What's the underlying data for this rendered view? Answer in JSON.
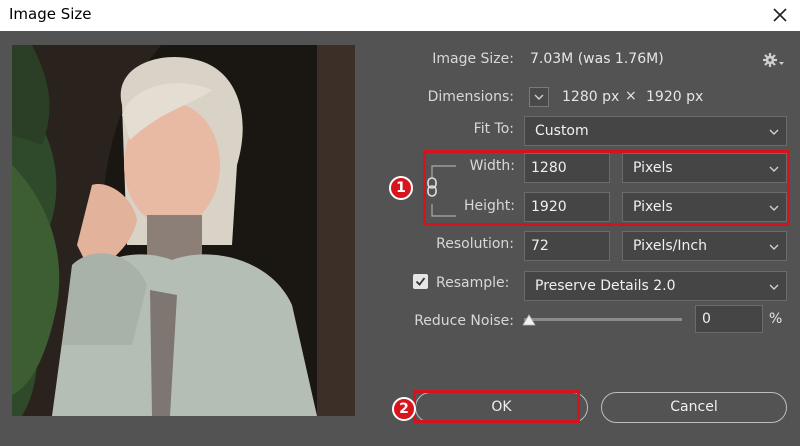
{
  "window": {
    "title": "Image Size"
  },
  "image_size": {
    "label": "Image Size:",
    "value": "7.03M (was 1.76M)"
  },
  "dimensions": {
    "label": "Dimensions:",
    "width": "1280 px",
    "separator": "×",
    "height": "1920 px"
  },
  "fit_to": {
    "label": "Fit To:",
    "value": "Custom"
  },
  "width": {
    "label": "Width:",
    "value": "1280",
    "unit": "Pixels"
  },
  "height": {
    "label": "Height:",
    "value": "1920",
    "unit": "Pixels"
  },
  "resolution": {
    "label": "Resolution:",
    "value": "72",
    "unit": "Pixels/Inch"
  },
  "resample": {
    "label": "Resample:",
    "checked": true,
    "value": "Preserve Details 2.0"
  },
  "reduce_noise": {
    "label": "Reduce Noise:",
    "value": "0",
    "unit": "%"
  },
  "buttons": {
    "ok": "OK",
    "cancel": "Cancel"
  },
  "annotations": {
    "step1": "1",
    "step2": "2"
  },
  "colors": {
    "dialog_bg": "#535353",
    "highlight": "#d4141c",
    "field_bg": "#454545"
  },
  "icons": {
    "settings": "gear-icon",
    "close": "close-icon",
    "link": "link-icon",
    "checkbox": "checkmark-icon"
  }
}
